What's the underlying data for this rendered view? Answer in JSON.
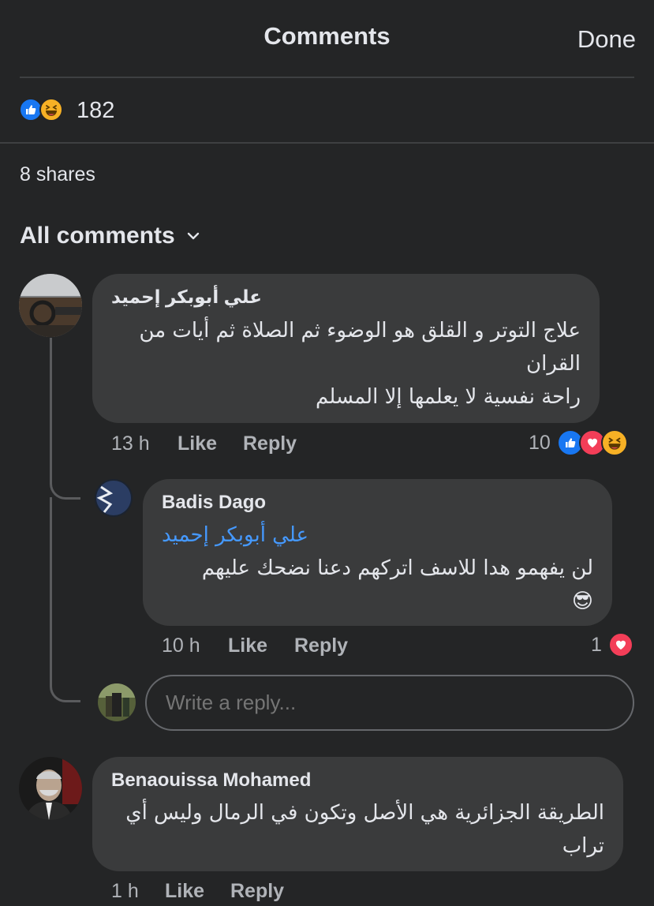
{
  "header": {
    "title": "Comments",
    "done_label": "Done"
  },
  "summary": {
    "reaction_count": "182",
    "reaction_icons": [
      "like",
      "haha"
    ],
    "shares": "8 shares"
  },
  "filter": {
    "label": "All comments"
  },
  "comments": [
    {
      "author": "علي أبوبكر إحميد",
      "text_lines": [
        "علاج التوتر و القلق هو الوضوء ثم الصلاة ثم أيات من",
        "القران",
        "راحة نفسية لا يعلمها إلا المسلم"
      ],
      "time": "13 h",
      "like_label": "Like",
      "reply_label": "Reply",
      "reaction_count": "10",
      "reaction_icons": [
        "like",
        "love",
        "haha"
      ]
    },
    {
      "author": "Badis Dago",
      "mention": "علي أبوبكر إحميد",
      "text_lines": [
        "لن يفهمو هدا للاسف اتركهم دعنا نضحك عليهم",
        "😎"
      ],
      "time": "10 h",
      "like_label": "Like",
      "reply_label": "Reply",
      "reaction_count": "1",
      "reaction_icons": [
        "love"
      ]
    },
    {
      "author": "Benaouissa Mohamed",
      "text_lines": [
        "الطريقة الجزائرية هي الأصل وتكون في الرمال وليس أي",
        "تراب"
      ],
      "time": "1 h",
      "like_label": "Like",
      "reply_label": "Reply"
    }
  ],
  "reply_box": {
    "placeholder": "Write a reply..."
  },
  "colors": {
    "background": "#242526",
    "bubble": "#3a3b3c",
    "like": "#1877f2",
    "love": "#f33e58",
    "haha": "#f7b125",
    "mention": "#4599ff"
  }
}
